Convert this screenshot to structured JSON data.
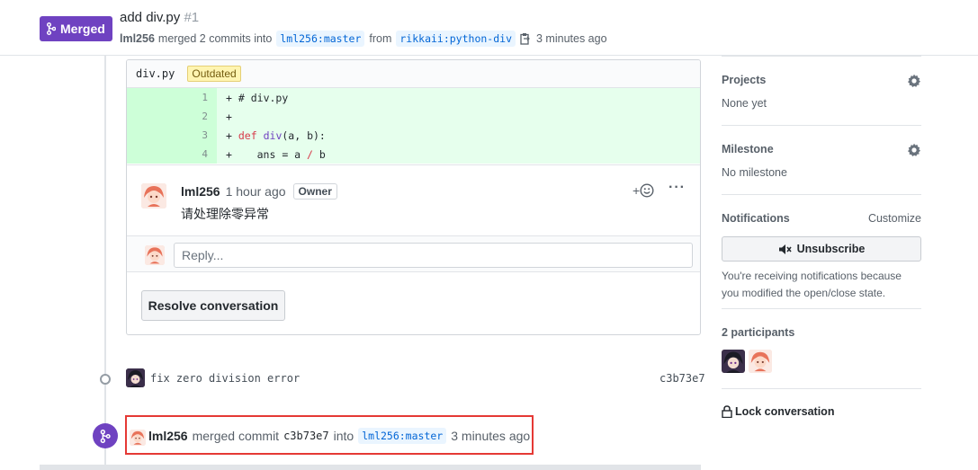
{
  "header": {
    "state_label": "Merged",
    "title": "add div.py",
    "number": "#1",
    "author": "lml256",
    "merged_text": "merged 2 commits into",
    "base_branch": "lml256:master",
    "from_text": "from",
    "head_branch": "rikkaii:python-div",
    "time": "3 minutes ago"
  },
  "review": {
    "file_name": "div.py",
    "outdated_label": "Outdated",
    "diff_lines": [
      {
        "num": "1",
        "marker": "+",
        "text": "# div.py"
      },
      {
        "num": "2",
        "marker": "+",
        "text": ""
      },
      {
        "num": "3",
        "marker": "+",
        "keyword": "def",
        "fn": "div",
        "rest": "(a, b):"
      },
      {
        "num": "4",
        "marker": "+",
        "pre": "    ans = a ",
        "op": "/",
        "post": " b"
      }
    ],
    "comment": {
      "author": "lml256",
      "time": "1 hour ago",
      "badge": "Owner",
      "body": "请处理除零异常",
      "reaction_label": "+",
      "more_label": "···"
    },
    "reply_placeholder": "Reply...",
    "resolve_label": "Resolve conversation"
  },
  "commit": {
    "message": "fix zero division error",
    "sha": "c3b73e7"
  },
  "merge_event": {
    "author": "lml256",
    "text": "merged commit",
    "sha": "c3b73e7",
    "into_text": "into",
    "branch": "lml256:master",
    "time": "3 minutes ago"
  },
  "sidebar": {
    "projects": {
      "title": "Projects",
      "value": "None yet"
    },
    "milestone": {
      "title": "Milestone",
      "value": "No milestone"
    },
    "notifications": {
      "title": "Notifications",
      "customize": "Customize",
      "button": "Unsubscribe",
      "reason": "You're receiving notifications because you modified the open/close state."
    },
    "participants": {
      "title": "2 participants"
    },
    "lock": "Lock conversation"
  },
  "colors": {
    "merged": "#6f42c1",
    "highlight_border": "#e53935",
    "diff_add": "#e6ffed"
  }
}
